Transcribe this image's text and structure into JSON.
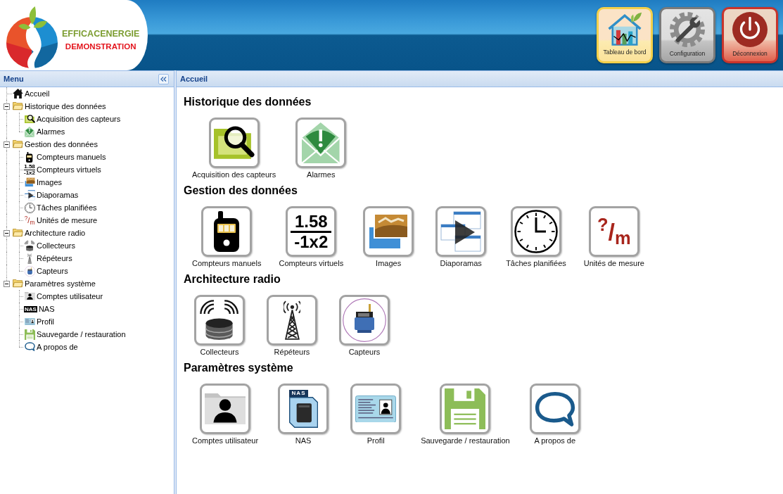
{
  "header": {
    "logo": {
      "brand": "EFFICACENERGIE",
      "tagline": "DEMONSTRATION"
    },
    "buttons": [
      {
        "label": "Tableau de bord",
        "kind": "dashboard"
      },
      {
        "label": "Configuration",
        "kind": "settings"
      },
      {
        "label": "Déconnexion",
        "kind": "power"
      }
    ]
  },
  "menu": {
    "title": "Menu",
    "tree": [
      {
        "label": "Accueil",
        "kind": "home"
      },
      {
        "label": "Historique des données",
        "kind": "folder",
        "expanded": true,
        "children": [
          {
            "label": "Acquisition des capteurs",
            "kind": "acquisition"
          },
          {
            "label": "Alarmes",
            "kind": "alarms"
          }
        ]
      },
      {
        "label": "Gestion des données",
        "kind": "folder",
        "expanded": true,
        "children": [
          {
            "label": "Compteurs manuels",
            "kind": "meter"
          },
          {
            "label": "Compteurs virtuels",
            "kind": "formula",
            "icon_text": [
              "1.58",
              "-1x2"
            ]
          },
          {
            "label": "Images",
            "kind": "images"
          },
          {
            "label": "Diaporamas",
            "kind": "slideshow"
          },
          {
            "label": "Tâches planifiées",
            "kind": "clock"
          },
          {
            "label": "Unités de mesure",
            "kind": "units",
            "icon_text": [
              "$^{?}$/$_{m}$"
            ]
          }
        ]
      },
      {
        "label": "Architecture radio",
        "kind": "folder",
        "expanded": true,
        "children": [
          {
            "label": "Collecteurs",
            "kind": "collector"
          },
          {
            "label": "Répéteurs",
            "kind": "repeater"
          },
          {
            "label": "Capteurs",
            "kind": "sensor"
          }
        ]
      },
      {
        "label": "Paramètres système",
        "kind": "folder",
        "expanded": true,
        "children": [
          {
            "label": "Comptes utilisateur",
            "kind": "user"
          },
          {
            "label": "NAS",
            "kind": "nas",
            "icon_text": [
              "NAS"
            ]
          },
          {
            "label": "Profil",
            "kind": "profile"
          },
          {
            "label": "Sauvegarde / restauration",
            "kind": "save"
          },
          {
            "label": "A propos de",
            "kind": "about"
          }
        ]
      }
    ]
  },
  "main": {
    "title": "Accueil",
    "sections": [
      {
        "title": "Historique des données",
        "items": [
          {
            "label": "Acquisition des capteurs",
            "kind": "acquisition"
          },
          {
            "label": "Alarmes",
            "kind": "alarms"
          }
        ]
      },
      {
        "title": "Gestion des données",
        "items": [
          {
            "label": "Compteurs manuels",
            "kind": "meter"
          },
          {
            "label": "Compteurs virtuels",
            "kind": "formula",
            "icon_text": [
              "1.58",
              "-1x2"
            ]
          },
          {
            "label": "Images",
            "kind": "images"
          },
          {
            "label": "Diaporamas",
            "kind": "slideshow"
          },
          {
            "label": "Tâches planifiées",
            "kind": "clock"
          },
          {
            "label": "Unités de mesure",
            "kind": "units",
            "icon_text": [
              "$^{?}$/$_{m}$"
            ]
          }
        ]
      },
      {
        "title": "Architecture radio",
        "items": [
          {
            "label": "Collecteurs",
            "kind": "collector"
          },
          {
            "label": "Répéteurs",
            "kind": "repeater"
          },
          {
            "label": "Capteurs",
            "kind": "sensor"
          }
        ]
      },
      {
        "title": "Paramètres système",
        "items": [
          {
            "label": "Comptes utilisateur",
            "kind": "user"
          },
          {
            "label": "NAS",
            "kind": "nas",
            "icon_text": [
              "NAS"
            ]
          },
          {
            "label": "Profil",
            "kind": "profile"
          },
          {
            "label": "Sauvegarde / restauration",
            "kind": "save"
          },
          {
            "label": "A propos de",
            "kind": "about"
          }
        ]
      }
    ]
  }
}
